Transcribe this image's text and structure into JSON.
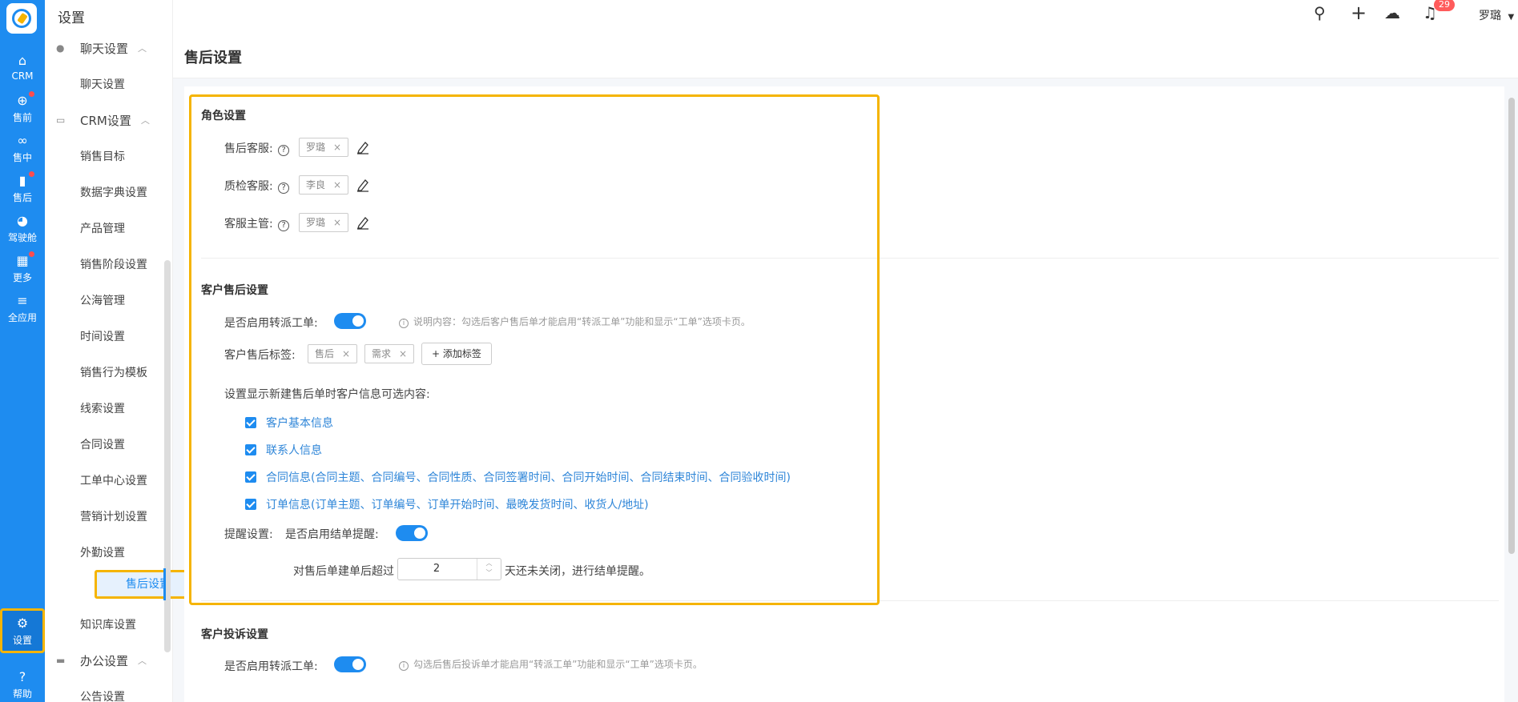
{
  "rail": {
    "items": [
      {
        "label": "CRM",
        "icon": "home-icon"
      },
      {
        "label": "售前",
        "icon": "pin-icon"
      },
      {
        "label": "售中",
        "icon": "handshake-icon"
      },
      {
        "label": "售后",
        "icon": "clipboard-icon"
      },
      {
        "label": "驾驶舱",
        "icon": "dashboard-icon"
      },
      {
        "label": "更多",
        "icon": "grid-icon"
      },
      {
        "label": "全应用",
        "icon": "menu-icon"
      },
      {
        "label": "设置",
        "icon": "gear-icon"
      },
      {
        "label": "帮助",
        "icon": "help-icon"
      }
    ]
  },
  "sidebar": {
    "title": "设置",
    "groups": {
      "chat": "聊天设置",
      "crm": "CRM设置",
      "office": "办公设置"
    },
    "items": [
      "聊天设置",
      "销售目标",
      "数据字典设置",
      "产品管理",
      "销售阶段设置",
      "公海管理",
      "时间设置",
      "销售行为模板",
      "线索设置",
      "合同设置",
      "工单中心设置",
      "营销计划设置",
      "外勤设置",
      "售后设置",
      "知识库设置",
      "公告设置"
    ]
  },
  "topbar": {
    "notification_count": "29",
    "user": "罗璐"
  },
  "page": {
    "title": "售后设置"
  },
  "role_settings": {
    "title": "角色设置",
    "rows": [
      {
        "label": "售后客服:",
        "tag": "罗璐"
      },
      {
        "label": "质检客服:",
        "tag": "李良"
      },
      {
        "label": "客服主管:",
        "tag": "罗璐"
      }
    ]
  },
  "customer_after_sale": {
    "title": "客户售后设置",
    "transfer_label": "是否启用转派工单:",
    "transfer_hint": "说明内容：勾选后客户售后单才能启用“转派工单”功能和显示“工单”选项卡页。",
    "tags_label": "客户售后标签:",
    "tags": [
      "售后",
      "需求"
    ],
    "add_tag": "+ 添加标签",
    "optional_label": "设置显示新建售后单时客户信息可选内容:",
    "options": [
      "客户基本信息",
      "联系人信息",
      "合同信息(合同主题、合同编号、合同性质、合同签署时间、合同开始时间、合同结束时间、合同验收时间)",
      "订单信息(订单主题、订单编号、订单开始时间、最晚发货时间、收货人/地址)"
    ],
    "remind_label": "提醒设置:",
    "remind_toggle_label": "是否启用结单提醒:",
    "remind_prefix": "对售后单建单后超过",
    "remind_days": "2",
    "remind_suffix": "天还未关闭，进行结单提醒。"
  },
  "complaint": {
    "title": "客户投诉设置",
    "transfer_label": "是否启用转派工单:",
    "transfer_hint": "勾选后售后投诉单才能启用“转派工单”功能和显示“工单”选项卡页。"
  },
  "colors": {
    "primary": "#1e8cf0",
    "highlight": "#f5b400"
  }
}
